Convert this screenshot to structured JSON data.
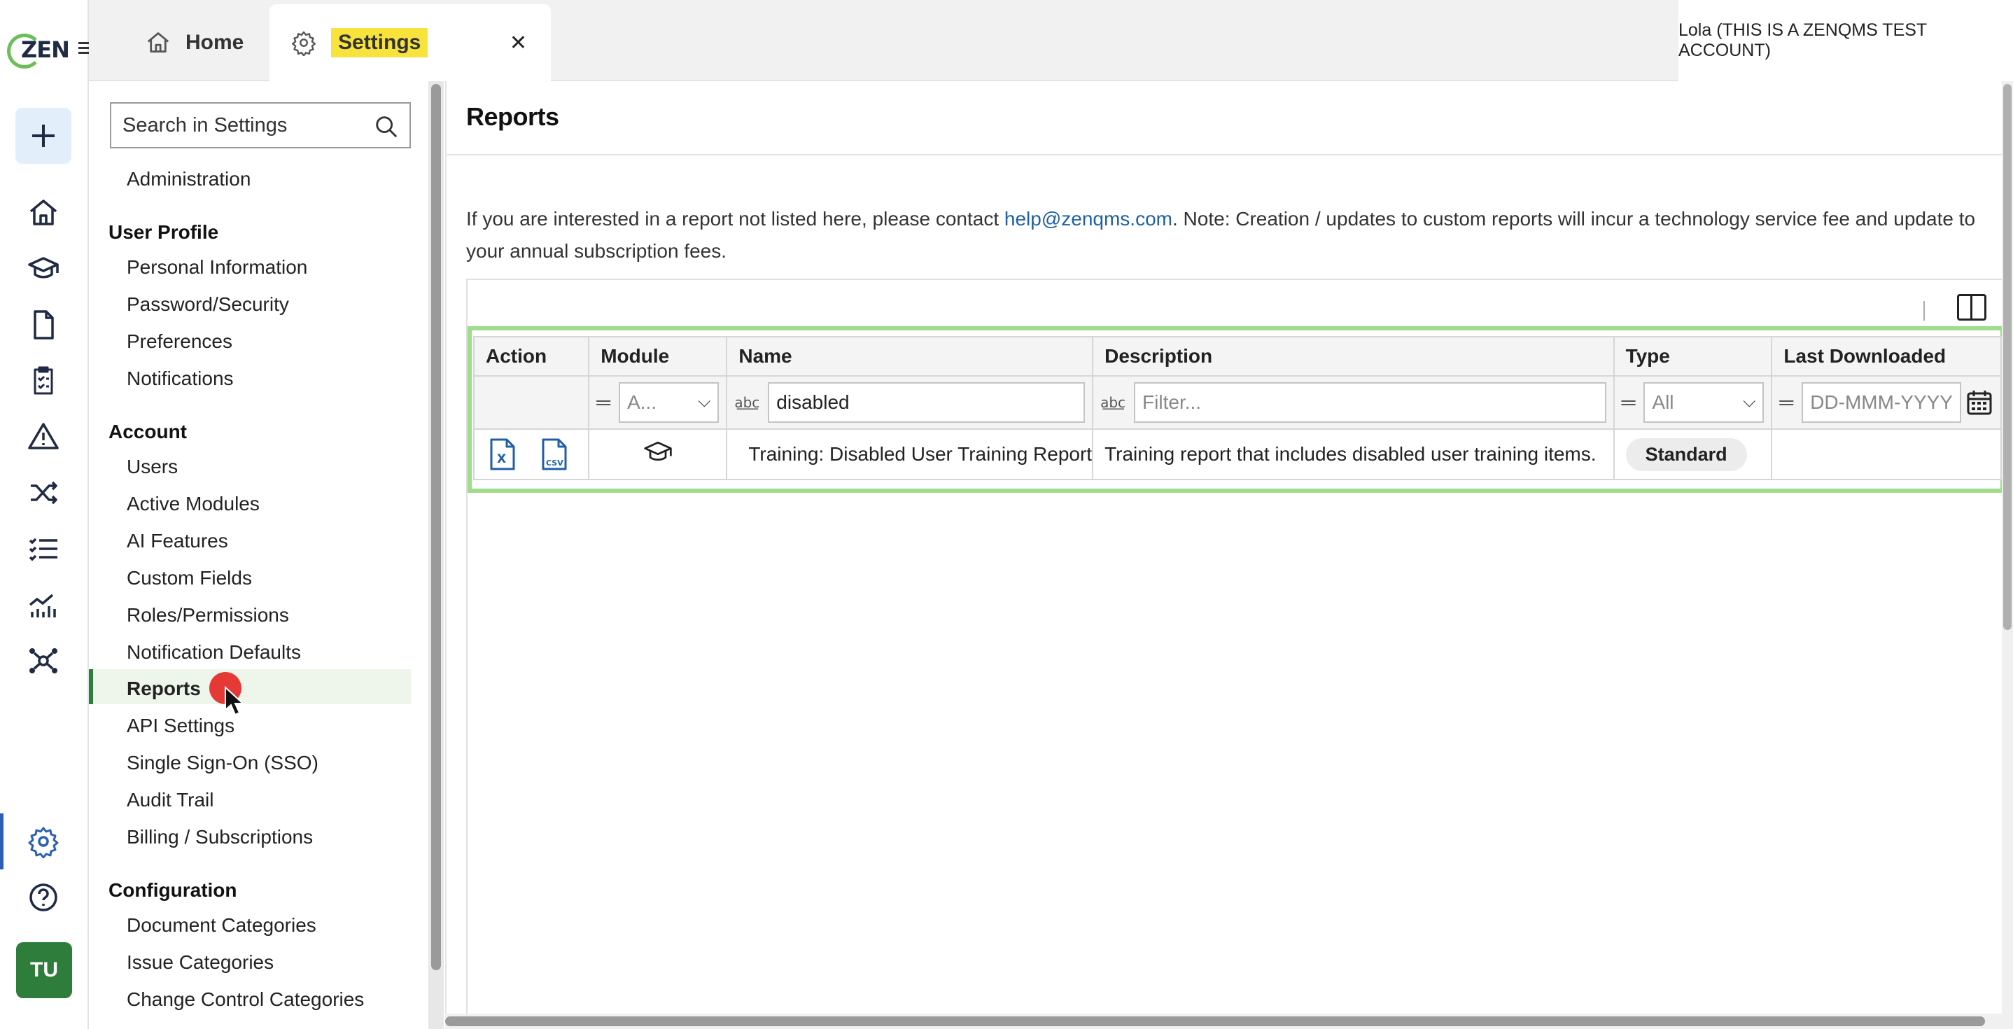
{
  "app": {
    "logo_text": "ZEN",
    "user_label": "Lola (THIS IS A ZENQMS TEST ACCOUNT)",
    "avatar_initials": "TU",
    "accent_color": "#2e7d3b",
    "highlight_color": "#f8e33d"
  },
  "tabs": [
    {
      "label": "Home",
      "icon": "home-icon"
    },
    {
      "label": "Settings",
      "icon": "gear-icon",
      "active": true
    }
  ],
  "rail": {
    "items": [
      "plus-icon",
      "home-icon",
      "graduation-cap-icon",
      "document-icon",
      "clipboard-icon",
      "warning-icon",
      "shuffle-icon",
      "checklist-icon",
      "chart-icon",
      "network-icon",
      "gear-icon",
      "help-icon"
    ]
  },
  "sidebar": {
    "search_placeholder": "Search in Settings",
    "top_item": "Administration",
    "sections": [
      {
        "heading": "User Profile",
        "items": [
          "Personal Information",
          "Password/Security",
          "Preferences",
          "Notifications"
        ]
      },
      {
        "heading": "Account",
        "items": [
          "Users",
          "Active Modules",
          "AI Features",
          "Custom Fields",
          "Roles/Permissions",
          "Notification Defaults",
          "Reports",
          "API Settings",
          "Single Sign-On (SSO)",
          "Audit Trail",
          "Billing / Subscriptions"
        ]
      },
      {
        "heading": "Configuration",
        "items": [
          "Document Categories",
          "Issue Categories",
          "Change Control Categories"
        ]
      }
    ],
    "active_item": "Reports"
  },
  "main": {
    "title": "Reports",
    "info_prefix": "If you are interested in a report not listed here, please contact ",
    "info_email": "help@zenqms.com",
    "info_suffix": ". Note: Creation / updates to custom reports will incur a technology service fee and update to your annual subscription fees.",
    "table": {
      "columns": [
        "Action",
        "Module",
        "Name",
        "Description",
        "Type",
        "Last Downloaded"
      ],
      "filters": {
        "module": "A...",
        "name": "disabled",
        "description_placeholder": "Filter...",
        "type": "All",
        "last_downloaded_placeholder": "DD-MMM-YYYY"
      },
      "rows": [
        {
          "actions": [
            "excel-export-icon",
            "csv-export-icon"
          ],
          "module_icon": "graduation-cap-icon",
          "name": "Training: Disabled User Training Report",
          "description": "Training report that includes disabled user training items.",
          "type": "Standard",
          "last_downloaded": ""
        }
      ]
    }
  }
}
